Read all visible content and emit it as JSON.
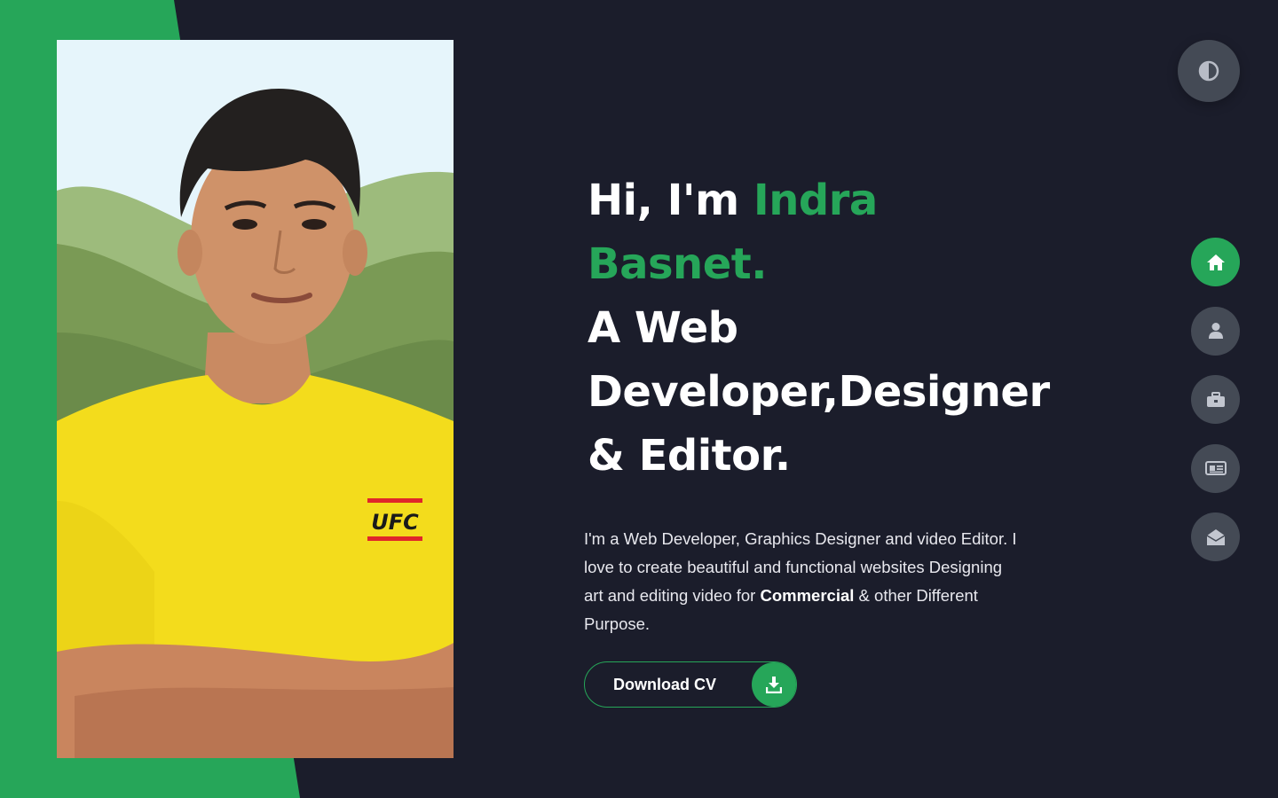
{
  "colors": {
    "accent": "#26a659",
    "background": "#1b1d2b",
    "nav_button": "#444a55"
  },
  "theme_toggle": {
    "icon": "contrast-icon"
  },
  "nav": {
    "items": [
      {
        "id": "home",
        "icon": "home-icon",
        "active": true
      },
      {
        "id": "about",
        "icon": "user-icon",
        "active": false
      },
      {
        "id": "portfolio",
        "icon": "briefcase-icon",
        "active": false
      },
      {
        "id": "blog",
        "icon": "newspaper-icon",
        "active": false
      },
      {
        "id": "contact",
        "icon": "envelope-open-icon",
        "active": false
      }
    ]
  },
  "hero": {
    "greeting": "Hi, I'm ",
    "name": "Indra Basnet.",
    "line2": "A Web",
    "line3": "Developer,Designer",
    "line4": "& Editor.",
    "intro_text": "I'm a Web Developer, Graphics Designer and video Editor. I love to create beautiful and functional websites Designing art and editing video for ",
    "intro_bold": "Commercial",
    "intro_tail": " & other Different Purpose.",
    "cv_label": "Download CV",
    "cv_icon": "download-icon"
  },
  "portrait": {
    "shirt_logo": "UFC"
  }
}
